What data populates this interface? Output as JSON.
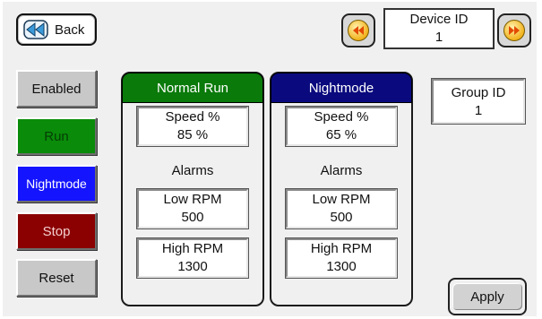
{
  "header": {
    "back_label": "Back",
    "device_id_label": "Device ID",
    "device_id_value": "1"
  },
  "modes": {
    "enabled": "Enabled",
    "run": "Run",
    "nightmode": "Nightmode",
    "stop": "Stop",
    "reset": "Reset"
  },
  "normal_run": {
    "title": "Normal Run",
    "speed_label": "Speed %",
    "speed_value": "85 %",
    "alarms_label": "Alarms",
    "low_rpm_label": "Low RPM",
    "low_rpm_value": "500",
    "high_rpm_label": "High RPM",
    "high_rpm_value": "1300"
  },
  "nightmode": {
    "title": "Nightmode",
    "speed_label": "Speed %",
    "speed_value": "65 %",
    "alarms_label": "Alarms",
    "low_rpm_label": "Low RPM",
    "low_rpm_value": "500",
    "high_rpm_label": "High RPM",
    "high_rpm_value": "1300"
  },
  "group": {
    "label": "Group ID",
    "value": "1"
  },
  "apply_label": "Apply",
  "colors": {
    "panel_background": "#f0f0f0",
    "run_green": "#0a8c0a",
    "nightmode_blue": "#1414ff",
    "stop_red": "#8b0000",
    "normal_run_header": "#0a7a0a",
    "nightmode_header": "#0a0a7e",
    "nav_arrow_gold": "#f2b21c"
  }
}
